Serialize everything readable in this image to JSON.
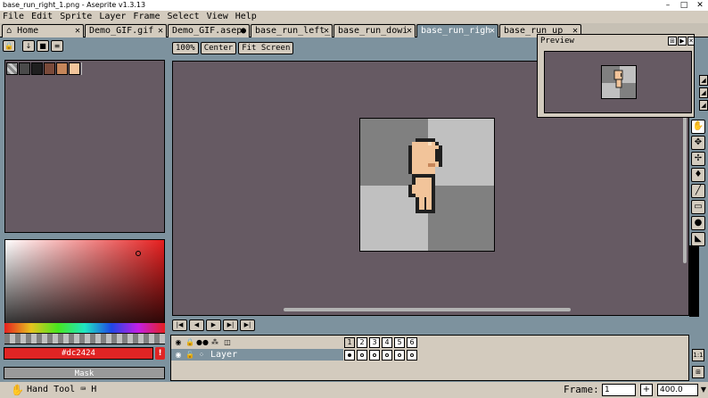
{
  "window": {
    "title": "base_run_right_1.png - Aseprite v1.3.13"
  },
  "menu": [
    "File",
    "Edit",
    "Sprite",
    "Layer",
    "Frame",
    "Select",
    "View",
    "Help"
  ],
  "tabs": [
    {
      "label": "Home",
      "close": "✕"
    },
    {
      "label": "Demo_GIF.gif",
      "close": "✕"
    },
    {
      "label": "Demo_GIF.asep",
      "close": "●"
    },
    {
      "label": "base_run_left_",
      "close": "✕"
    },
    {
      "label": "base_run_dowi",
      "close": "✕"
    },
    {
      "label": "base_run_righ",
      "close": "✕"
    },
    {
      "label": "base_run_up_",
      "close": "✕"
    }
  ],
  "palette": [
    "#4a4a4a",
    "#1f1f1f",
    "#7a4a3a",
    "#c6865a",
    "#f2c49a",
    "#fde0c0"
  ],
  "color": {
    "hex": "#dc2424",
    "warning": "!"
  },
  "mask_label": "Mask",
  "zoom_buttons": [
    "100%",
    "Center",
    "Fit Screen"
  ],
  "preview": {
    "title": "Preview"
  },
  "timeline": {
    "layer_name": "Layer",
    "frames": [
      "1",
      "2",
      "3",
      "4",
      "5",
      "6"
    ]
  },
  "status": {
    "tool": "Hand Tool",
    "shortcut": "H",
    "frame_label": "Frame:",
    "frame_value": "1",
    "zoom_value": "400.0",
    "plus": "+"
  },
  "colors": {
    "canvas_bg": "#665a63",
    "chrome": "#d3cbbe",
    "window_bg": "#7d929e",
    "accent": "#dc2424",
    "skin": "#f2c49a",
    "outline": "#1f1f1f"
  }
}
